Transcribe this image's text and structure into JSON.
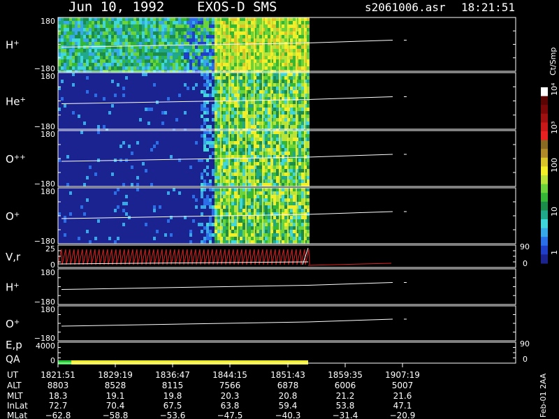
{
  "header": {
    "date": "Jun 10, 1992",
    "mission": "EXOS-D SMS",
    "file": "s2061006.asr",
    "time": "18:21:51"
  },
  "colors": {
    "background": "#000000",
    "plasma_blue": "#1a238f",
    "text": "#ffffff",
    "velocity_trace": "#e02020",
    "qa_good": "#22cc33",
    "qa_ok": "#f2ee28"
  },
  "panels": [
    {
      "id": "h-plus",
      "label": "H",
      "sup": "+",
      "ytop": "180",
      "ybot": "−180",
      "kind": "spectrogram"
    },
    {
      "id": "he-plus",
      "label": "He",
      "sup": "+",
      "ytop": "180",
      "ybot": "−180",
      "kind": "spectrogram"
    },
    {
      "id": "o-plus-plus",
      "label": "O",
      "sup": "++",
      "ytop": "180",
      "ybot": "−180",
      "kind": "spectrogram"
    },
    {
      "id": "o-plus",
      "label": "O",
      "sup": "+",
      "ytop": "180",
      "ybot": "−180",
      "kind": "spectrogram"
    },
    {
      "id": "vr",
      "label": "V,r",
      "sup": "",
      "ytop": "25",
      "ybot": "0",
      "rtop": "90",
      "rbot": "0",
      "kind": "velocity"
    },
    {
      "id": "h-plus-2",
      "label": "H",
      "sup": "+",
      "ytop": "180",
      "ybot": "−180",
      "kind": "line"
    },
    {
      "id": "o-plus-2",
      "label": "O",
      "sup": "+",
      "ytop": "180",
      "ybot": "−180",
      "kind": "line"
    },
    {
      "id": "ep-qa",
      "label": "E,p",
      "label2": "QA",
      "sup": "",
      "ytop": "4000",
      "ybot": "0",
      "rtop": "90",
      "rbot": "0",
      "kind": "qa"
    }
  ],
  "colorbar": {
    "unit": "Ct/Smp",
    "labels": [
      "1",
      "10",
      "100",
      "10³",
      "10⁴"
    ],
    "colors": [
      "#1a238f",
      "#1f3fc8",
      "#2a6ee8",
      "#38a9e8",
      "#3fd6dc",
      "#1fa88a",
      "#1c8c4a",
      "#34b836",
      "#6ad43a",
      "#b8e43a",
      "#f2ee28",
      "#d9c52a",
      "#b08a28",
      "#8a6a22",
      "#e82020",
      "#c81818",
      "#a01010",
      "#7a0808",
      "#5a0404",
      "#ffffff"
    ]
  },
  "time_axis": {
    "row_labels": [
      "UT",
      "ALT",
      "MLT",
      "InLat",
      "MLat"
    ],
    "columns": [
      {
        "UT": "1821:51",
        "ALT": "8803",
        "MLT": "18.3",
        "InLat": "72.7",
        "MLat": "−62.8"
      },
      {
        "UT": "1829:19",
        "ALT": "8528",
        "MLT": "19.1",
        "InLat": "70.4",
        "MLat": "−58.8"
      },
      {
        "UT": "1836:47",
        "ALT": "8115",
        "MLT": "19.8",
        "InLat": "67.5",
        "MLat": "−53.6"
      },
      {
        "UT": "1844:15",
        "ALT": "7566",
        "MLT": "20.3",
        "InLat": "63.8",
        "MLat": "−47.5"
      },
      {
        "UT": "1851:43",
        "ALT": "6878",
        "MLT": "20.8",
        "InLat": "59.4",
        "MLat": "−40.3"
      },
      {
        "UT": "1859:35",
        "ALT": "6006",
        "MLT": "21.2",
        "InLat": "53.8",
        "MLat": "−31.4"
      },
      {
        "UT": "1907:19",
        "ALT": "5007",
        "MLT": "21.6",
        "InLat": "47.1",
        "MLat": "−20.9"
      }
    ]
  },
  "stamp": "Feb-01 2AA",
  "chart_data": {
    "type": "heatmap",
    "title": "Jun 10, 1992   EXOS-D SMS",
    "xlabel": "UT",
    "x_ticks": [
      "1821:51",
      "1829:19",
      "1836:47",
      "1844:15",
      "1851:43",
      "1859:35",
      "1907:19"
    ],
    "data_coverage": {
      "start": "1821:51",
      "end": "1854:30"
    },
    "energy_onset_UT": "1842:00",
    "colorbar_unit": "Ct/Smp",
    "colorbar_scale": "log",
    "colorbar_range": [
      1,
      10000
    ],
    "series": [
      {
        "name": "H+",
        "ylim": [
          -180,
          180
        ]
      },
      {
        "name": "He+",
        "ylim": [
          -180,
          180
        ]
      },
      {
        "name": "O++",
        "ylim": [
          -180,
          180
        ]
      },
      {
        "name": "O+",
        "ylim": [
          -180,
          180
        ]
      },
      {
        "name": "V,r",
        "ylim": [
          0,
          25
        ]
      },
      {
        "name": "H+",
        "ylim": [
          -180,
          180
        ]
      },
      {
        "name": "O+",
        "ylim": [
          -180,
          180
        ]
      },
      {
        "name": "E,p",
        "ylim": [
          0,
          4000
        ]
      }
    ],
    "qa": [
      {
        "from": "1821:51",
        "to": "1823:35",
        "color": "#22cc33"
      },
      {
        "from": "1823:35",
        "to": "1854:30",
        "color": "#f2ee28"
      }
    ]
  }
}
